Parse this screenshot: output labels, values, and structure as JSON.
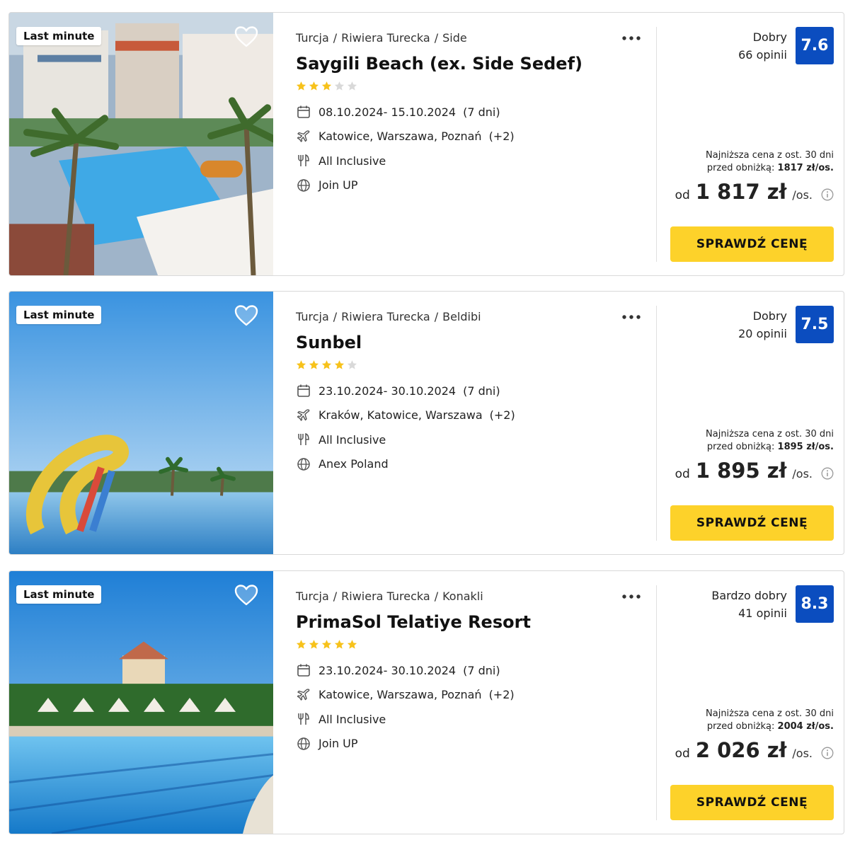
{
  "colors": {
    "score_badge": "#0b4dbf",
    "cta_button": "#fdd22a",
    "star_filled": "#f7c21b",
    "star_empty": "#d9d9d9"
  },
  "offers": [
    {
      "badge": "Last minute",
      "breadcrumb": [
        "Turcja",
        "Riwiera Turecka",
        "Side"
      ],
      "breadcrumb_sep": "/",
      "name": "Saygili Beach (ex. Side Sedef)",
      "stars": 3,
      "dates": "08.10.2024- 15.10.2024",
      "duration": "(7 dni)",
      "departure": "Katowice, Warszawa, Poznań",
      "departure_more": "(+2)",
      "board": "All Inclusive",
      "operator": "Join UP",
      "rating_label": "Dobry",
      "reviews": "66 opinii",
      "score": "7.6",
      "lowest_line1": "Najniższa cena z ost. 30 dni",
      "lowest_line2_prefix": "przed obniżką:",
      "lowest_price": "1817 zł/os.",
      "price_prefix": "od",
      "price": "1 817 zł",
      "price_suffix": "/os.",
      "cta": "SPRAWDŹ CENĘ",
      "icons": {
        "favorite": "heart-icon",
        "more": "more-dots-icon",
        "calendar": "calendar-icon",
        "plane": "plane-icon",
        "board": "cutlery-icon",
        "operator": "globe-icon",
        "info": "info-icon"
      }
    },
    {
      "badge": "Last minute",
      "breadcrumb": [
        "Turcja",
        "Riwiera Turecka",
        "Beldibi"
      ],
      "breadcrumb_sep": "/",
      "name": "Sunbel",
      "stars": 4,
      "dates": "23.10.2024- 30.10.2024",
      "duration": "(7 dni)",
      "departure": "Kraków, Katowice, Warszawa",
      "departure_more": "(+2)",
      "board": "All Inclusive",
      "operator": "Anex Poland",
      "rating_label": "Dobry",
      "reviews": "20 opinii",
      "score": "7.5",
      "lowest_line1": "Najniższa cena z ost. 30 dni",
      "lowest_line2_prefix": "przed obniżką:",
      "lowest_price": "1895 zł/os.",
      "price_prefix": "od",
      "price": "1 895 zł",
      "price_suffix": "/os.",
      "cta": "SPRAWDŹ CENĘ",
      "icons": {
        "favorite": "heart-icon",
        "more": "more-dots-icon",
        "calendar": "calendar-icon",
        "plane": "plane-icon",
        "board": "cutlery-icon",
        "operator": "globe-icon",
        "info": "info-icon"
      }
    },
    {
      "badge": "Last minute",
      "breadcrumb": [
        "Turcja",
        "Riwiera Turecka",
        "Konakli"
      ],
      "breadcrumb_sep": "/",
      "name": "PrimaSol Telatiye Resort",
      "stars": 5,
      "dates": "23.10.2024- 30.10.2024",
      "duration": "(7 dni)",
      "departure": "Katowice, Warszawa, Poznań",
      "departure_more": "(+2)",
      "board": "All Inclusive",
      "operator": "Join UP",
      "rating_label": "Bardzo dobry",
      "reviews": "41 opinii",
      "score": "8.3",
      "lowest_line1": "Najniższa cena z ost. 30 dni",
      "lowest_line2_prefix": "przed obniżką:",
      "lowest_price": "2004 zł/os.",
      "price_prefix": "od",
      "price": "2 026 zł",
      "price_suffix": "/os.",
      "cta": "SPRAWDŹ CENĘ",
      "icons": {
        "favorite": "heart-icon",
        "more": "more-dots-icon",
        "calendar": "calendar-icon",
        "plane": "plane-icon",
        "board": "cutlery-icon",
        "operator": "globe-icon",
        "info": "info-icon"
      }
    }
  ]
}
